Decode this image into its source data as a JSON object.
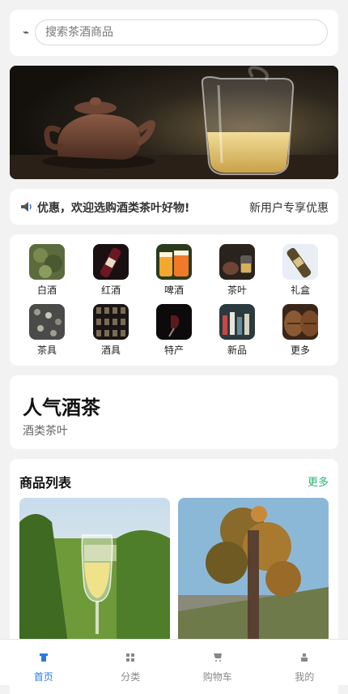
{
  "search": {
    "placeholder": "搜索茶酒商品",
    "icon": "lightning-icon"
  },
  "banner": {
    "slides": 2,
    "active_slide": 1
  },
  "notice": {
    "icon": "megaphone-icon",
    "text": "享优惠，欢迎选购酒类茶叶好物!",
    "promo": "新用户专享优惠"
  },
  "categories": [
    {
      "label": "白酒"
    },
    {
      "label": "红酒"
    },
    {
      "label": "啤酒"
    },
    {
      "label": "茶叶"
    },
    {
      "label": "礼盒"
    },
    {
      "label": "茶具"
    },
    {
      "label": "酒具"
    },
    {
      "label": "特产"
    },
    {
      "label": "新品"
    },
    {
      "label": "更多"
    }
  ],
  "popular": {
    "title": "人气酒茶",
    "subtitle": "酒类茶叶"
  },
  "product_list": {
    "title": "商品列表",
    "more": "更多"
  },
  "tabbar": {
    "items": [
      {
        "label": "首页",
        "active": true
      },
      {
        "label": "分类",
        "active": false
      },
      {
        "label": "购物车",
        "active": false
      },
      {
        "label": "我的",
        "active": false
      }
    ]
  },
  "colors": {
    "accent": "#2b7ad8",
    "more_link": "#2bb673",
    "background": "#f2f2f2"
  }
}
